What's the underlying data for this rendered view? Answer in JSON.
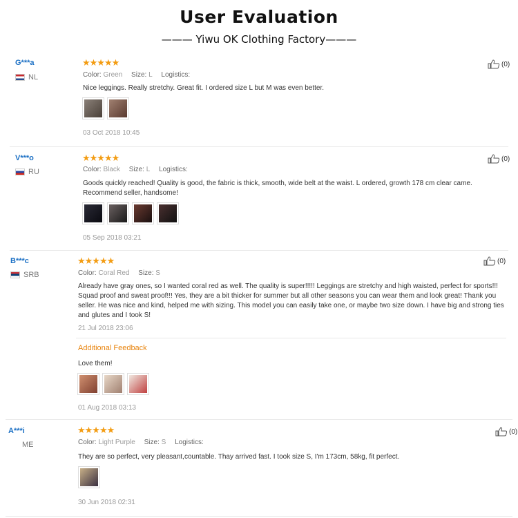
{
  "header": {
    "title": "User Evaluation",
    "subtitle": "——— Yiwu OK Clothing Factory———"
  },
  "labels": {
    "color": "Color:",
    "size": "Size:",
    "logistics": "Logistics:"
  },
  "reviews": [
    {
      "user": "G***a",
      "country": "NL",
      "stars": "★★★★★",
      "color": "Green",
      "size": "L",
      "text": "Nice leggings. Really stretchy. Great fit. I ordered size L but M was even better.",
      "date": "03 Oct 2018 10:45",
      "likes": "(0)",
      "thumb_colors": [
        "#5a5048",
        "#7a5a4a"
      ]
    },
    {
      "user": "V***o",
      "country": "RU",
      "stars": "★★★★★",
      "color": "Black",
      "size": "L",
      "text": "Goods quickly reached! Quality is good, the fabric is thick, smooth, wide belt at the waist. L ordered, growth 178 cm clear came. Recommend seller, handsome!",
      "date": "05 Sep 2018 03:21",
      "likes": "(0)",
      "thumb_colors": [
        "#1a1a22",
        "#3a3a40",
        "#4a2a2a",
        "#2a2020"
      ]
    },
    {
      "user": "B***c",
      "country": "SRB",
      "stars": "★★★★★",
      "color": "Coral Red",
      "size": "S",
      "text": "Already have gray ones, so I wanted coral red as well. The quality is super!!!!! Leggings are stretchy and high waisted, perfect for sports!!! Squad proof and sweat proof!!! Yes, they are a bit thicker for summer but all other seasons you can wear them and look great! Thank you seller. He was nice and kind, helped me with sizing. This model you can easily take one, or maybe two size down. I have big and strong ties and glutes and I took S!",
      "date": "21 Jul 2018 23:06",
      "likes": "(0)",
      "additional": {
        "title": "Additional Feedback",
        "text": "Love them!",
        "date": "01 Aug 2018 03:13",
        "thumb_colors": [
          "#b0604a",
          "#c8a890",
          "#c04040"
        ]
      }
    },
    {
      "user": "A***i",
      "country": "ME",
      "stars": "★★★★★",
      "color": "Light Purple",
      "size": "S",
      "text": "They are so perfect, very pleasant,countable. Thay arrived fast. I took size S, I'm 173cm, 58kg, fit perfect.",
      "date": "30 Jun 2018 02:31",
      "likes": "(0)",
      "thumb_colors": [
        "#6a5a7a"
      ]
    }
  ],
  "icons": {
    "like": "thumbs-up-icon",
    "star": "star-icon",
    "flag": "flag-icon"
  },
  "colors": {
    "accent_blue": "#1a6fc4",
    "star_orange": "#f39c12",
    "feedback_orange": "#e8840e"
  }
}
